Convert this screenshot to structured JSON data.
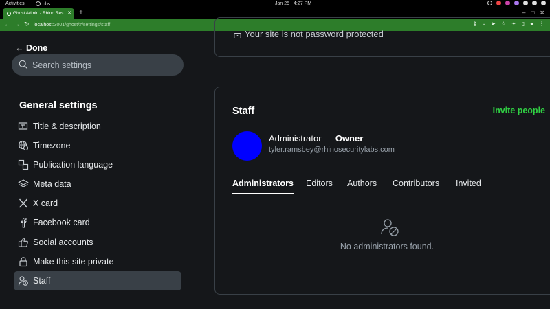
{
  "os": {
    "activities": "Activities",
    "app": "obs",
    "date": "Jan 25",
    "time": "4:27 PM"
  },
  "browser": {
    "tab_title": "Ghost Admin - Rhino Res",
    "url_host": "localhost",
    "url_rest": ":3001/ghost/#/settings/staff"
  },
  "sidebar": {
    "done_label": "Done",
    "search_placeholder": "Search settings",
    "section_title": "General settings",
    "items": [
      {
        "label": "Title & description",
        "icon": "title-description-icon"
      },
      {
        "label": "Timezone",
        "icon": "globe-clock-icon"
      },
      {
        "label": "Publication language",
        "icon": "language-icon"
      },
      {
        "label": "Meta data",
        "icon": "layers-icon"
      },
      {
        "label": "X card",
        "icon": "x-logo-icon"
      },
      {
        "label": "Facebook card",
        "icon": "facebook-logo-icon"
      },
      {
        "label": "Social accounts",
        "icon": "thumbs-up-icon"
      },
      {
        "label": "Make this site private",
        "icon": "lock-icon"
      },
      {
        "label": "Staff",
        "icon": "staff-icon",
        "active": true
      }
    ]
  },
  "main": {
    "password_notice": "Your site is not password protected",
    "staff": {
      "title": "Staff",
      "invite_label": "Invite people",
      "owner_name": "Administrator",
      "owner_sep": " — ",
      "owner_role": "Owner",
      "owner_email": "tyler.ramsbey@rhinosecuritylabs.com",
      "avatar_color": "#0000ff",
      "tabs": [
        "Administrators",
        "Editors",
        "Authors",
        "Contributors",
        "Invited"
      ],
      "active_tab": "Administrators",
      "empty_message": "No administrators found."
    }
  },
  "colors": {
    "accent_green": "#30cf43",
    "browser_green": "#2d7d2a"
  }
}
